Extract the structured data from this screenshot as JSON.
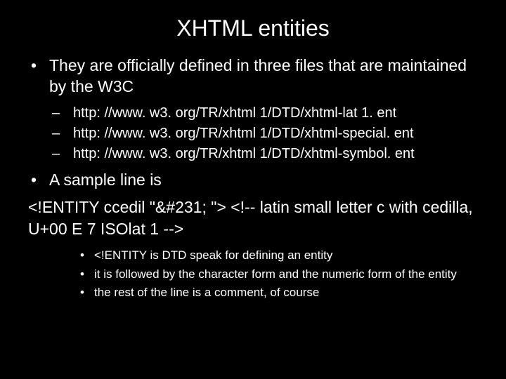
{
  "title": "XHTML entities",
  "bullets": {
    "b1": "They are officially defined in three files that are maintained by the W3C",
    "urls": [
      "http: //www. w3. org/TR/xhtml 1/DTD/xhtml-lat 1. ent",
      "http: //www. w3. org/TR/xhtml 1/DTD/xhtml-special. ent",
      "http: //www. w3. org/TR/xhtml 1/DTD/xhtml-symbol. ent"
    ],
    "b2": "A sample line is",
    "sample": "<!ENTITY ccedil \"&#231; \"> <!-- latin small letter c with cedilla, U+00 E 7 ISOlat 1 -->",
    "notes": [
      "<!ENTITY is DTD speak for defining an entity",
      "it is followed by the character form and the numeric form of the entity",
      "the rest of the line is a comment, of course"
    ]
  }
}
